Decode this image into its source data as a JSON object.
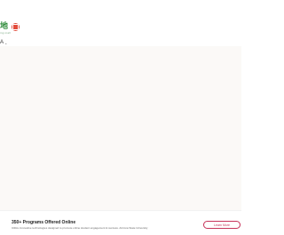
{
  "header": {
    "logo": {
      "text": "地",
      "subtext": "ing mall"
    },
    "language": {
      "label": "A",
      "caret": "⌄"
    }
  },
  "footer": {
    "promo_title": "350+ Programs Offered Online",
    "promo_description": "Utilize innovative technologies designed to promote online student engagement & success. Arizona State University",
    "learn_more_label": "Learn More"
  },
  "colors": {
    "logo_green": "#2e8b3a",
    "seal_red": "#e24b3b",
    "accent": "#c7345a",
    "content_background": "#fbf9f7"
  }
}
